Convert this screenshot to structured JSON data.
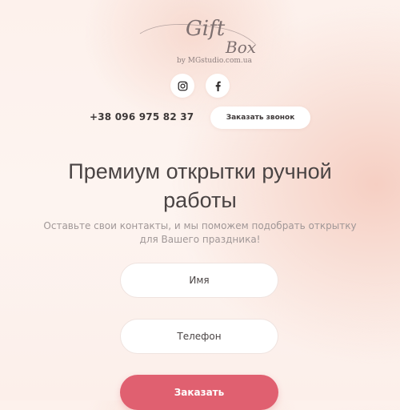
{
  "brand": {
    "logo_text_line1": "Gift",
    "logo_text_line2": "Box",
    "byline": "by MGstudio.com.ua"
  },
  "social": [
    {
      "icon": "instagram-icon"
    },
    {
      "icon": "facebook-icon"
    }
  ],
  "header": {
    "phone": "+38 096 975 82 37",
    "callback_label": "Заказать звонок"
  },
  "hero": {
    "title": "Премиум открытки ручной работы",
    "subtitle": "Оставьте свои контакты, и мы поможем подобрать открытку для Вашего праздника!"
  },
  "form": {
    "name_placeholder": "Имя",
    "phone_placeholder": "Телефон",
    "submit_label": "Заказать"
  },
  "colors": {
    "accent": "#e06070",
    "background": "#fdf1ec"
  }
}
